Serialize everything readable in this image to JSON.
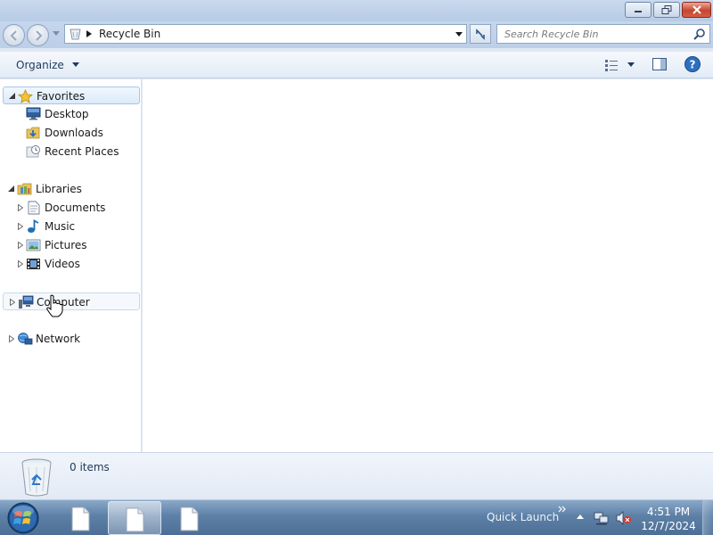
{
  "window": {
    "caption_buttons": [
      "minimize",
      "maximize",
      "close"
    ]
  },
  "address_bar": {
    "location_icon": "recycle-bin-icon",
    "breadcrumb": "Recycle Bin"
  },
  "search": {
    "placeholder": "Search Recycle Bin"
  },
  "toolbar": {
    "organize_label": "Organize"
  },
  "navigation": {
    "favorites": {
      "label": "Favorites",
      "items": [
        {
          "label": "Desktop",
          "icon": "desktop-icon"
        },
        {
          "label": "Downloads",
          "icon": "downloads-icon"
        },
        {
          "label": "Recent Places",
          "icon": "recent-places-icon"
        }
      ]
    },
    "libraries": {
      "label": "Libraries",
      "items": [
        {
          "label": "Documents",
          "icon": "documents-icon"
        },
        {
          "label": "Music",
          "icon": "music-icon"
        },
        {
          "label": "Pictures",
          "icon": "pictures-icon"
        },
        {
          "label": "Videos",
          "icon": "videos-icon"
        }
      ]
    },
    "computer": {
      "label": "Computer",
      "icon": "computer-icon"
    },
    "network": {
      "label": "Network",
      "icon": "network-icon"
    }
  },
  "details": {
    "item_count": "0 items"
  },
  "taskbar": {
    "quick_launch": "Quick Launch",
    "time": "4:51 PM",
    "date": "12/7/2024"
  },
  "colors": {
    "selection_border": "#a9c6e6",
    "taskbar": "#5d80a7",
    "close_button": "#c7452f"
  }
}
